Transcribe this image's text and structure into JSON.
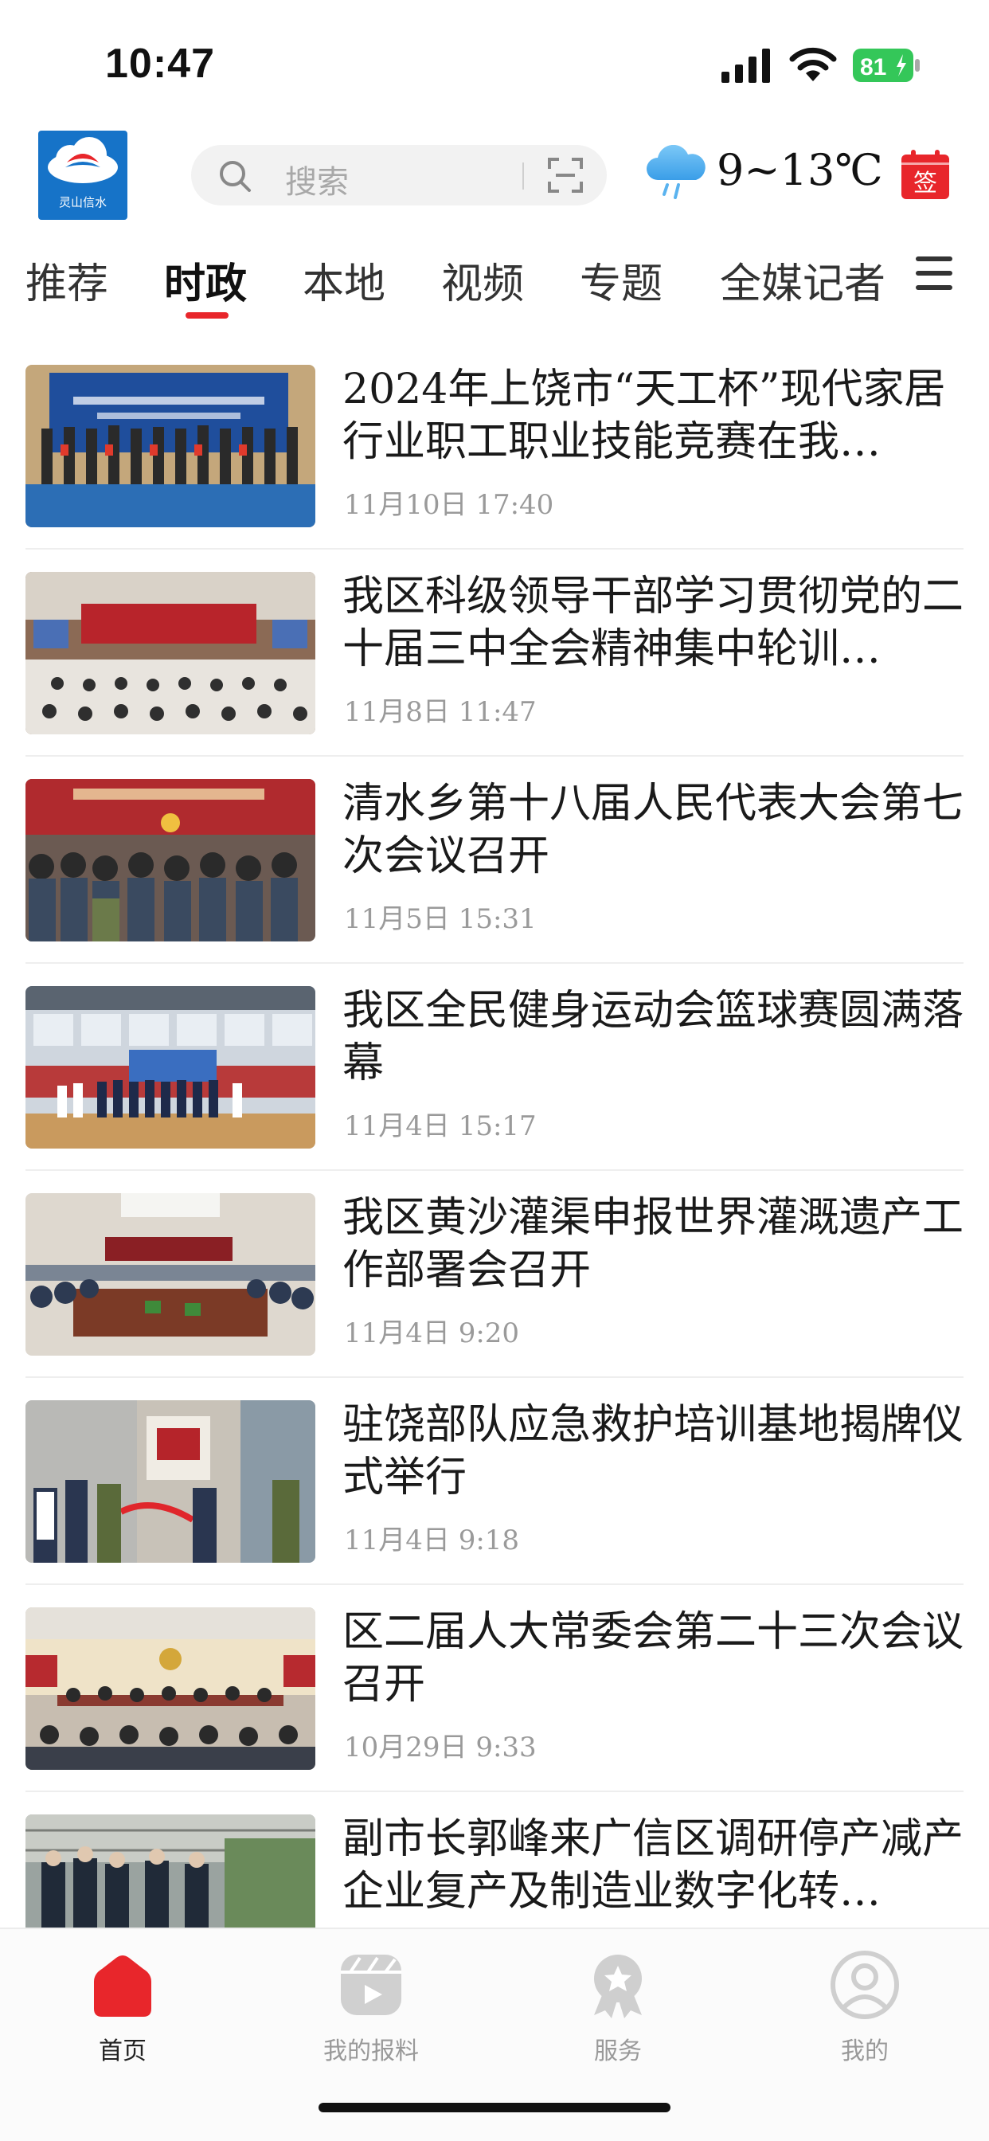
{
  "status_bar": {
    "time": "10:47",
    "battery": "81"
  },
  "header": {
    "logo_text": "灵山信水",
    "search_placeholder": "搜索",
    "weather_temp": "9~13℃",
    "sign_label": "签"
  },
  "tabs": [
    {
      "label": "推荐",
      "active": false
    },
    {
      "label": "时政",
      "active": true
    },
    {
      "label": "本地",
      "active": false
    },
    {
      "label": "视频",
      "active": false
    },
    {
      "label": "专题",
      "active": false
    },
    {
      "label": "全媒记者",
      "active": false
    }
  ],
  "news": [
    {
      "title": "2024年上饶市“天工杯”现代家居行业职工职业技能竞赛在我…",
      "date": "11月10日 17:40"
    },
    {
      "title": "我区科级领导干部学习贯彻党的二十届三中全会精神集中轮训…",
      "date": "11月8日 11:47"
    },
    {
      "title": "清水乡第十八届人民代表大会第七次会议召开",
      "date": "11月5日 15:31"
    },
    {
      "title": "我区全民健身运动会篮球赛圆满落幕",
      "date": "11月4日 15:17"
    },
    {
      "title": "我区黄沙灌渠申报世界灌溉遗产工作部署会召开",
      "date": "11月4日 9:20"
    },
    {
      "title": "驻饶部队应急救护培训基地揭牌仪式举行",
      "date": "11月4日 9:18"
    },
    {
      "title": "区二届人大常委会第二十三次会议召开",
      "date": "10月29日 9:33"
    },
    {
      "title": "副市长郭峰来广信区调研停产减产企业复产及制造业数字化转…",
      "date": ""
    }
  ],
  "bottom_nav": [
    {
      "label": "首页",
      "icon": "home-icon",
      "active": true
    },
    {
      "label": "我的报料",
      "icon": "video-icon",
      "active": false
    },
    {
      "label": "服务",
      "icon": "medal-icon",
      "active": false
    },
    {
      "label": "我的",
      "icon": "profile-icon",
      "active": false
    }
  ],
  "colors": {
    "accent": "#e8262b",
    "logo_bg": "#1673c8",
    "battery": "#34c759"
  }
}
